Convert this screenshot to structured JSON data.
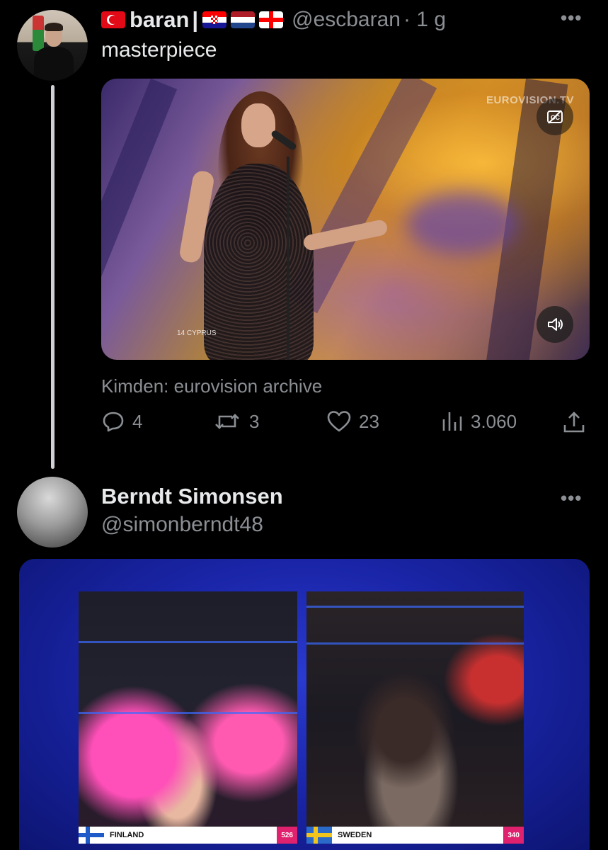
{
  "tweet1": {
    "name": "baran",
    "separator": "|",
    "handle": "@escbaran",
    "time": "· 1 g",
    "text": "masterpiece",
    "media": {
      "watermark": "EUROVISION.TV",
      "caption_tag": "14 CYPRUS"
    },
    "source": "Kimden: eurovision archive",
    "actions": {
      "replies": "4",
      "retweets": "3",
      "likes": "23",
      "views": "3.060"
    },
    "more": "•••"
  },
  "tweet2": {
    "name": "Berndt Simonsen",
    "handle": "@simonberndt48",
    "more": "•••",
    "media": {
      "left_country": "FINLAND",
      "left_score": "526",
      "right_country": "SWEDEN",
      "right_score": "340"
    }
  }
}
